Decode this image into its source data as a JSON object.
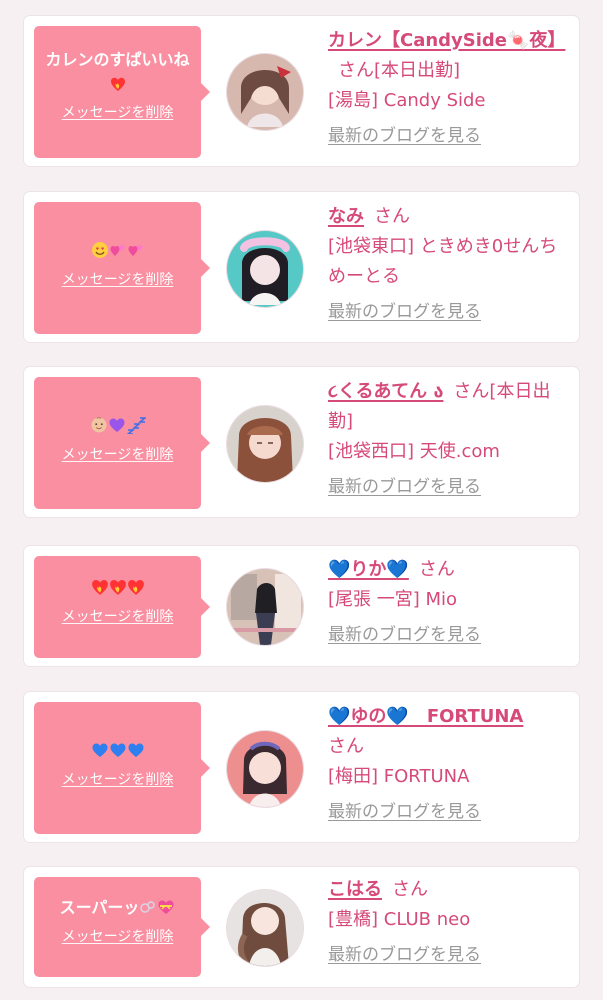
{
  "messages": [
    {
      "bubble_text": "カレンのすぱいいね",
      "bubble_icons": [
        "heart-on-fire-icon"
      ],
      "delete_label": "メッセージを削除",
      "name": "カレン【CandySide🍬夜】",
      "honorific": "さん",
      "status": "[本日出勤]",
      "shop": "[湯島] Candy Side",
      "blog_label": "最新のブログを見る"
    },
    {
      "bubble_text": "",
      "bubble_icons": [
        "smiling-face-with-heart-eyes-icon",
        "two-hearts-icon",
        "two-hearts-icon"
      ],
      "delete_label": "メッセージを削除",
      "name": "なみ",
      "honorific": "さん",
      "status": "",
      "shop": "[池袋東口] ときめき0せんちめーとる",
      "blog_label": "最新のブログを見る"
    },
    {
      "bubble_text": "",
      "bubble_icons": [
        "baby-icon",
        "purple-heart-icon",
        "zzz-icon"
      ],
      "delete_label": "メッセージを削除",
      "name": "૮くるあてん ა",
      "honorific": "さん",
      "status": "[本日出勤]",
      "shop": "[池袋西口] 天使.com",
      "blog_label": "最新のブログを見る"
    },
    {
      "bubble_text": "",
      "bubble_icons": [
        "heart-on-fire-icon",
        "heart-on-fire-icon",
        "heart-on-fire-icon"
      ],
      "delete_label": "メッセージを削除",
      "name": "💙りか💙",
      "honorific": "さん",
      "status": "",
      "shop": "[尾張 一宮] Mio",
      "blog_label": "最新のブログを見る"
    },
    {
      "bubble_text": "",
      "bubble_icons": [
        "blue-heart-icon",
        "blue-heart-icon",
        "blue-heart-icon"
      ],
      "delete_label": "メッセージを削除",
      "name": "💙ゆの💙　FORTUNA",
      "honorific": "さん",
      "status": "",
      "shop": "[梅田] FORTUNA",
      "blog_label": "最新のブログを見る"
    },
    {
      "bubble_text": "スーパーッ",
      "bubble_icons": [
        "bubbles-icon",
        "heart-with-ribbon-icon"
      ],
      "delete_label": "メッセージを削除",
      "name": "こはる",
      "honorific": "さん",
      "status": "",
      "shop": "[豊橋] CLUB neo",
      "blog_label": "最新のブログを見る"
    }
  ],
  "colors": {
    "accent": "#d64a79",
    "bubble": "#f98fa0",
    "muted": "#999999",
    "background": "#f6f0f2"
  }
}
